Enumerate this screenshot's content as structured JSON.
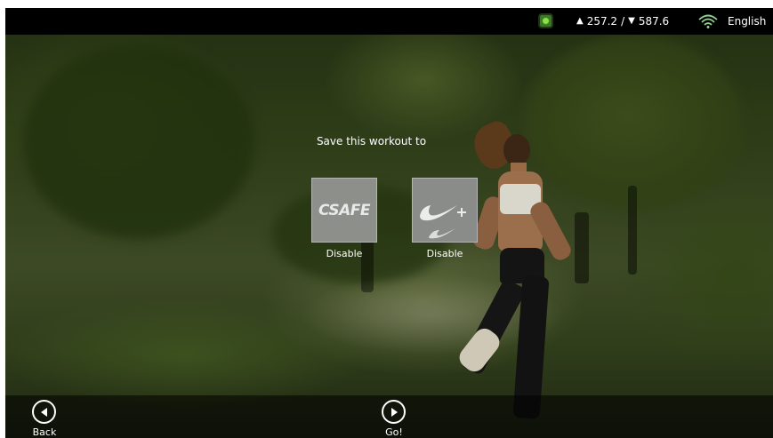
{
  "status_bar": {
    "upload_value": "257.2",
    "separator": "/",
    "download_value": "587.6",
    "language": "English"
  },
  "main": {
    "prompt": "Save this workout to",
    "options": [
      {
        "logo_text": "CSAFE",
        "status": "Disable"
      },
      {
        "logo_text": "Nike+",
        "status": "Disable"
      }
    ]
  },
  "nav": {
    "back_label": "Back",
    "go_label": "Go!"
  },
  "colors": {
    "status_bar_bg": "#000000",
    "tile_bg": "#8d8f8b",
    "text": "#ffffff",
    "chip_icon": "#8be04a"
  },
  "icons": {
    "chip": "chip-icon",
    "upload": "triangle-up-icon",
    "download": "triangle-down-icon",
    "wifi": "wifi-icon",
    "back": "circle-arrow-left-icon",
    "go": "circle-arrow-right-icon",
    "nike": "nike-swoosh-icon"
  }
}
